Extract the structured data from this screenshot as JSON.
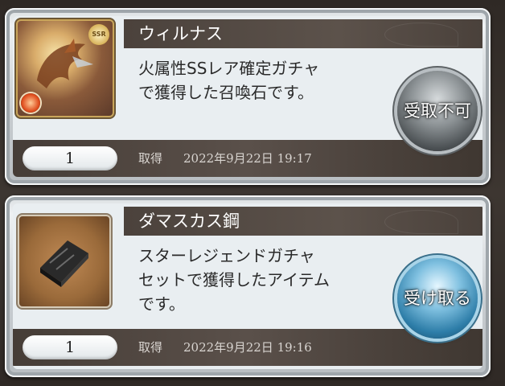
{
  "items": [
    {
      "name": "ウィルナス",
      "description_lines": [
        "火属性SSレア確定ガチャ",
        "で獲得した召喚石です。"
      ],
      "quantity": "1",
      "acquired_label": "取得",
      "acquired_date": "2022年9月22日 19:17",
      "button_label": "受取不可",
      "badge": "SSR",
      "thumbnail_icon": "dragon-icon",
      "element_icon": "fire-element-icon"
    },
    {
      "name": "ダマスカス鋼",
      "description_lines": [
        "スターレジェンドガチャ",
        "セットで獲得したアイテム",
        "です。"
      ],
      "quantity": "1",
      "acquired_label": "取得",
      "acquired_date": "2022年9月22日 19:16",
      "button_label": "受け取る",
      "thumbnail_icon": "steel-ingot-icon"
    }
  ],
  "colors": {
    "title_bar": "#4b423c",
    "button_disabled": "#8d9396",
    "button_receive": "#2d7da8",
    "card_body": "#e9eef1"
  }
}
